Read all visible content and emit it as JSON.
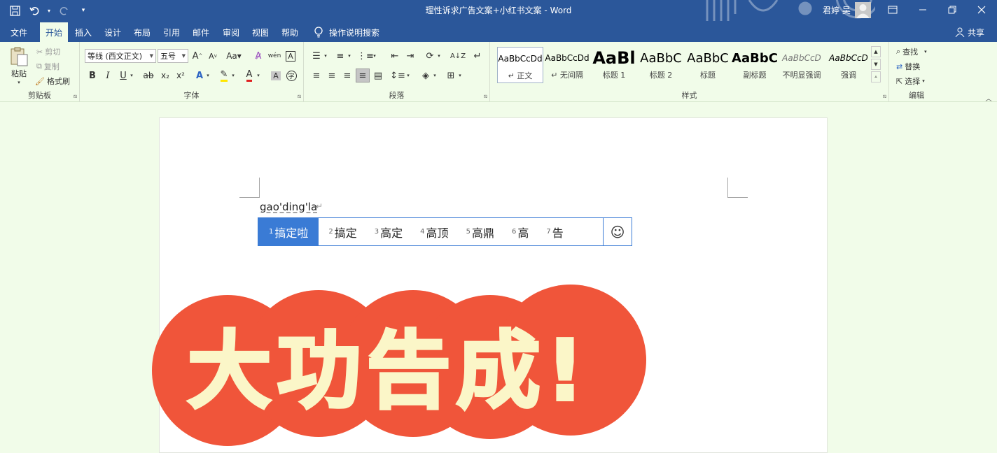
{
  "titlebar": {
    "doc_title": "理性诉求广告文案+小红书文案 - Word",
    "user_name": "君婷 吴",
    "accent": "#2b579a"
  },
  "tabs": [
    "文件",
    "开始",
    "插入",
    "设计",
    "布局",
    "引用",
    "邮件",
    "审阅",
    "视图",
    "帮助"
  ],
  "tell_me": "操作说明搜索",
  "share": "共享",
  "clipboard": {
    "paste": "粘贴",
    "cut": "剪切",
    "copy": "复制",
    "format_painter": "格式刷",
    "label": "剪贴板"
  },
  "font": {
    "name": "等线 (西文正文)",
    "size": "五号",
    "label": "字体"
  },
  "paragraph": {
    "label": "段落"
  },
  "styles": {
    "label": "样式",
    "items": [
      {
        "sample": "AaBbCcDd",
        "name": "↵ 正文"
      },
      {
        "sample": "AaBbCcDd",
        "name": "↵ 无间隔"
      },
      {
        "sample": "AaBl",
        "name": "标题 1"
      },
      {
        "sample": "AaBbC",
        "name": "标题 2"
      },
      {
        "sample": "AaBbC",
        "name": "标题"
      },
      {
        "sample": "AaBbC",
        "name": "副标题"
      },
      {
        "sample": "AaBbCcD",
        "name": "不明显强调"
      },
      {
        "sample": "AaBbCcD",
        "name": "强调"
      }
    ]
  },
  "editing": {
    "find": "查找",
    "replace": "替换",
    "select": "选择",
    "label": "编辑"
  },
  "document": {
    "typed_text": "gao'ding'la",
    "para_mark": "↵"
  },
  "ime": {
    "candidates": [
      {
        "num": "1",
        "text": "搞定啦"
      },
      {
        "num": "2",
        "text": "搞定"
      },
      {
        "num": "3",
        "text": "高定"
      },
      {
        "num": "4",
        "text": "高顶"
      },
      {
        "num": "5",
        "text": "高鼎"
      },
      {
        "num": "6",
        "text": "高"
      },
      {
        "num": "7",
        "text": "告"
      }
    ],
    "emoji": "☺"
  },
  "sticker": {
    "text": "大功告成!",
    "fill": "#f0553a",
    "text_color": "#fbf6c8"
  }
}
